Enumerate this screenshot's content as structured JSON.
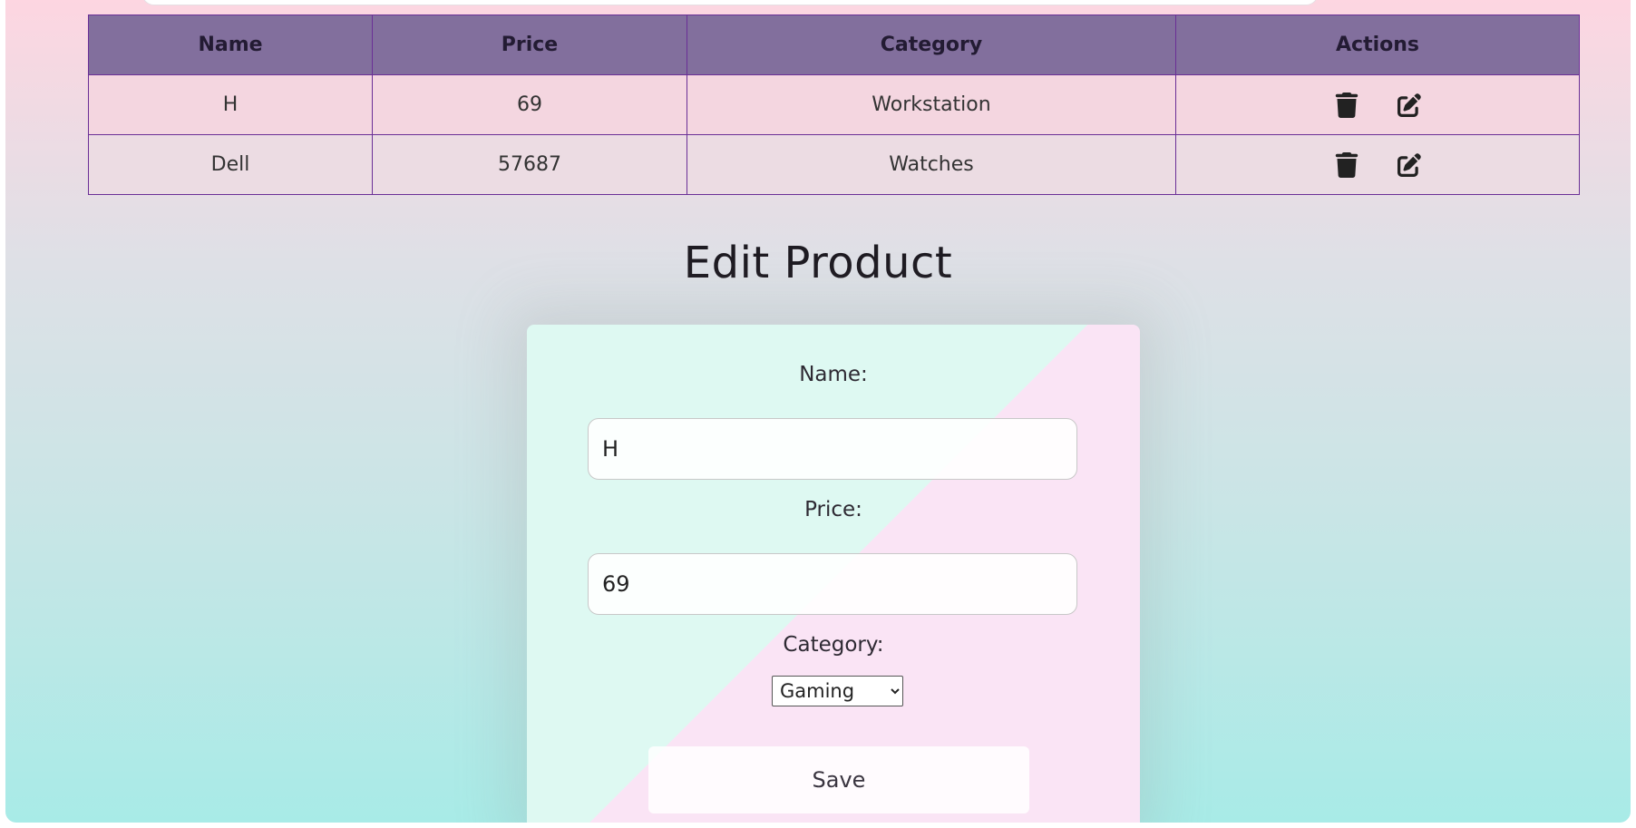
{
  "table": {
    "headers": [
      "Name",
      "Price",
      "Category",
      "Actions"
    ],
    "rows": [
      {
        "name": "H",
        "price": "69",
        "category": "Workstation"
      },
      {
        "name": "Dell",
        "price": "57687",
        "category": "Watches"
      }
    ],
    "row_actions": [
      "trash-icon",
      "edit-icon"
    ]
  },
  "edit_form": {
    "title": "Edit Product",
    "name_label": "Name:",
    "name_value": "H",
    "price_label": "Price:",
    "price_value": "69",
    "category_label": "Category:",
    "category_selected": "Gaming",
    "save_label": "Save"
  },
  "colors": {
    "table_header_bg": "#826f9d",
    "table_border": "#6a2f96",
    "card_left": "#def9f2",
    "card_right": "#fae4f5",
    "page_top": "#fdd6e1",
    "page_bottom": "#a8ebe7"
  }
}
